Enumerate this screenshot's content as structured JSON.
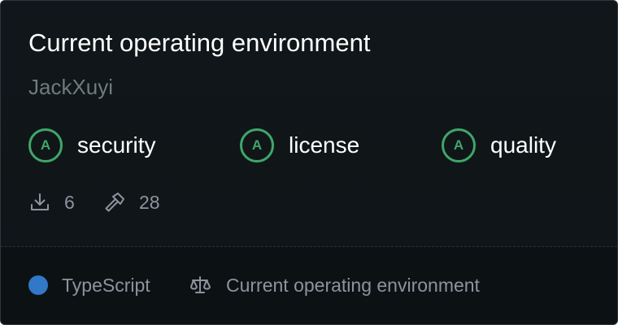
{
  "repo": {
    "title": "Current operating environment",
    "owner": "JackXuyi"
  },
  "scores": [
    {
      "grade": "A",
      "label": "security"
    },
    {
      "grade": "A",
      "label": "license"
    },
    {
      "grade": "A",
      "label": "quality"
    }
  ],
  "stats": {
    "downloads": "6",
    "builds": "28"
  },
  "footer": {
    "language": "TypeScript",
    "license": "Current operating environment"
  },
  "colors": {
    "background": "#0f1518",
    "grade_green": "#3fa66a",
    "language_dot": "#3178c6",
    "muted_text": "#8b949e"
  },
  "icons": {
    "downloads": "download-icon",
    "builds": "hammer-icon",
    "license": "scale-icon"
  }
}
